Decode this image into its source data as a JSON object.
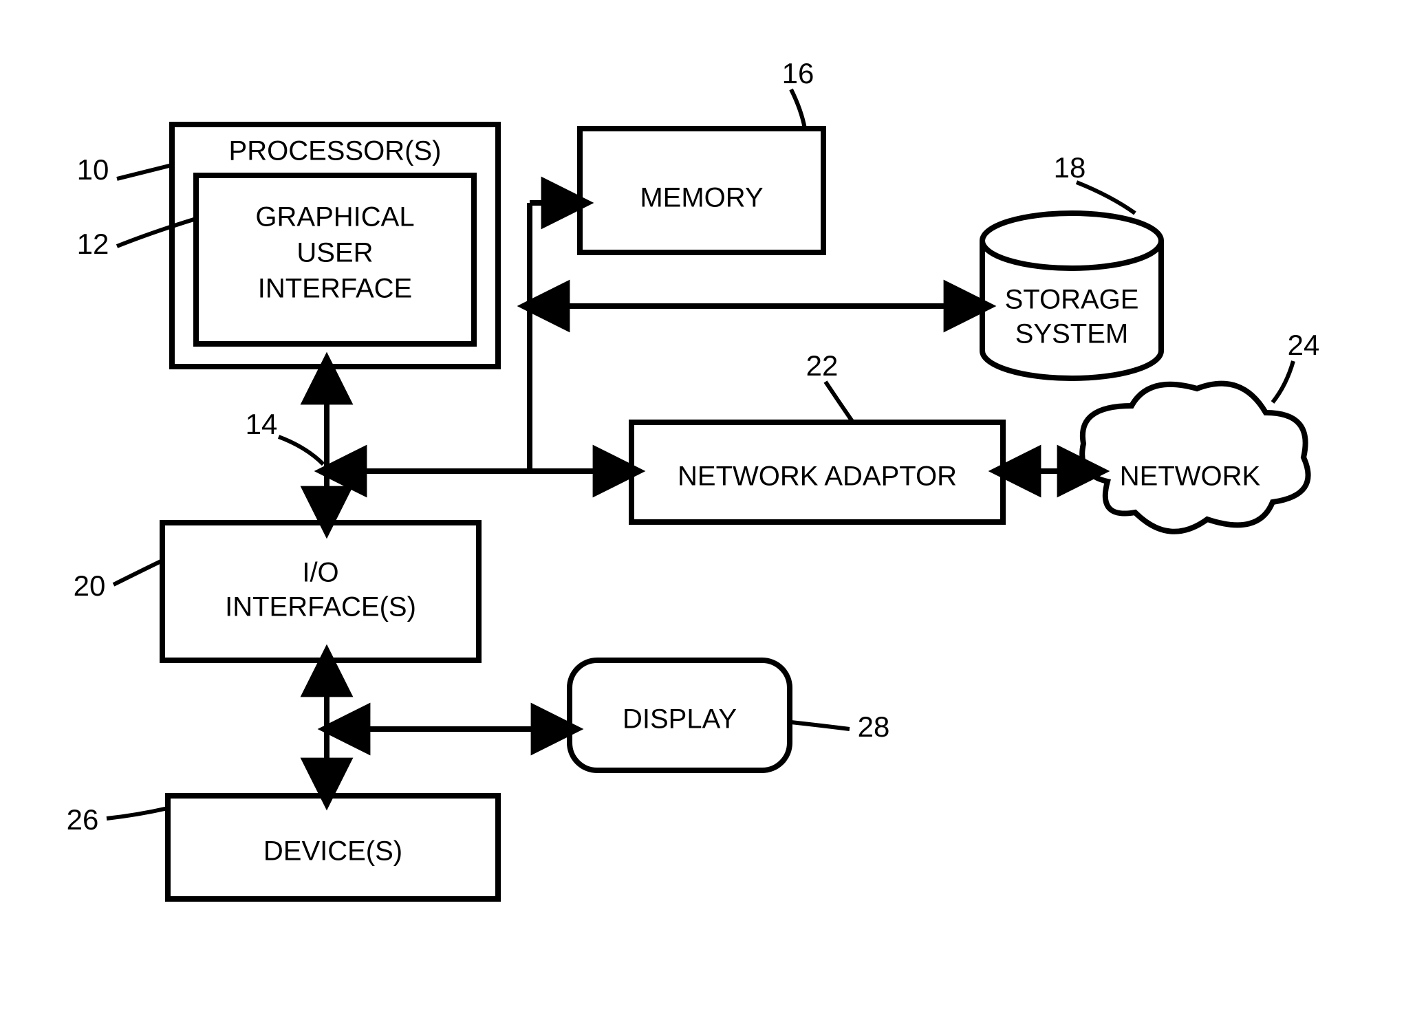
{
  "boxes": {
    "processor": {
      "title": "PROCESSOR(S)",
      "ref": "10"
    },
    "gui": {
      "line1": "GRAPHICAL",
      "line2": "USER",
      "line3": "INTERFACE",
      "ref": "12"
    },
    "memory": {
      "title": "MEMORY",
      "ref": "16"
    },
    "storage": {
      "line1": "STORAGE",
      "line2": "SYSTEM",
      "ref": "18"
    },
    "netadaptor": {
      "title": "NETWORK ADAPTOR",
      "ref": "22"
    },
    "network": {
      "title": "NETWORK",
      "ref": "24"
    },
    "io": {
      "line1": "I/O",
      "line2": "INTERFACE(S)",
      "ref": "20"
    },
    "display": {
      "title": "DISPLAY",
      "ref": "28"
    },
    "devices": {
      "title": "DEVICE(S)",
      "ref": "26"
    },
    "bus": {
      "ref": "14"
    }
  }
}
